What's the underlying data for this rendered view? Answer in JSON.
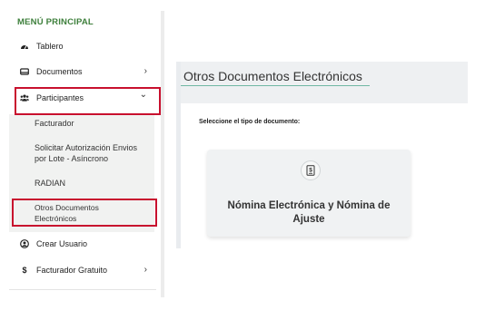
{
  "sidebar": {
    "title": "MENÚ PRINCIPAL",
    "items": {
      "tablero": "Tablero",
      "documentos": "Documentos",
      "participantes": "Participantes",
      "crear_usuario": "Crear Usuario",
      "facturador_gratuito": "Facturador Gratuito"
    },
    "submenu": {
      "facturador": "Facturador",
      "solicitar_line1": "Solicitar Autorización Envios",
      "solicitar_line2": "por Lote - Asíncrono",
      "radian": "RADIAN",
      "otros_line1": "Otros Documentos",
      "otros_line2": "Electrónicos"
    },
    "chevron_right": "›",
    "chevron_down": "⌄",
    "dollar": "$"
  },
  "main": {
    "title": "Otros Documentos Electrónicos",
    "select_label": "Seleccione el tipo de documento:",
    "card_title": "Nómina Electrónica y Nómina de Ajuste"
  },
  "colors": {
    "menu_title": "#3d7f3b",
    "highlight_border": "#c8102e",
    "header_underline": "#6fb7a3"
  }
}
